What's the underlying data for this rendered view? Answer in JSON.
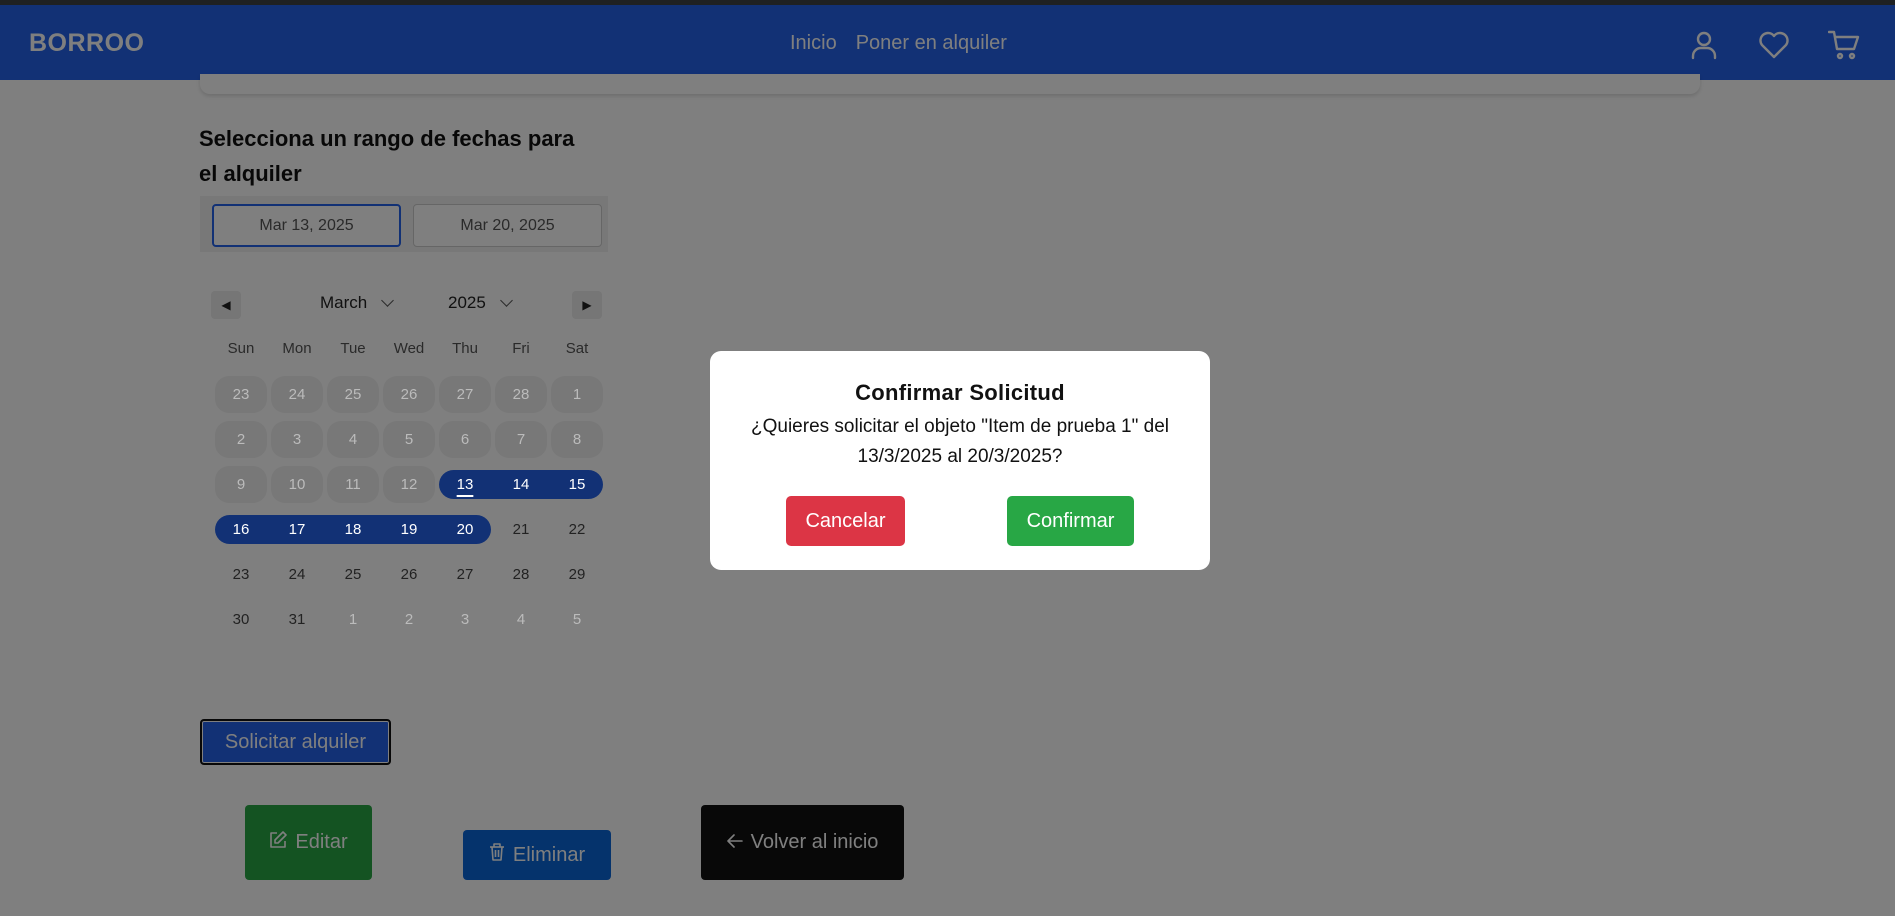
{
  "navbar": {
    "brand": "BORROO",
    "links": [
      "Inicio",
      "Poner en alquiler"
    ]
  },
  "rental": {
    "heading": "Selecciona un rango de fechas para el alquiler",
    "start_date": "Mar 13, 2025",
    "end_date": "Mar 20, 2025"
  },
  "calendar": {
    "month": "March",
    "year": "2025",
    "weekdays": [
      "Sun",
      "Mon",
      "Tue",
      "Wed",
      "Thu",
      "Fri",
      "Sat"
    ],
    "weeks": [
      [
        "23",
        "24",
        "25",
        "26",
        "27",
        "28",
        "1"
      ],
      [
        "2",
        "3",
        "4",
        "5",
        "6",
        "7",
        "8"
      ],
      [
        "9",
        "10",
        "11",
        "12",
        "13",
        "14",
        "15"
      ],
      [
        "16",
        "17",
        "18",
        "19",
        "20",
        "21",
        "22"
      ],
      [
        "23",
        "24",
        "25",
        "26",
        "27",
        "28",
        "29"
      ],
      [
        "30",
        "31",
        "1",
        "2",
        "3",
        "4",
        "5"
      ]
    ],
    "selected_range": [
      "13",
      "20"
    ],
    "accent": "#2563eb"
  },
  "actions": {
    "solicitar": "Solicitar alquiler",
    "editar": "Editar",
    "eliminar": "Eliminar",
    "volver": "Volver al inicio"
  },
  "modal": {
    "title": "Confirmar Solicitud",
    "message": "¿Quieres solicitar el objeto \"Item de prueba 1\" del 13/3/2025 al 20/3/2025?",
    "cancel": "Cancelar",
    "confirm": "Confirmar"
  },
  "colors": {
    "primary": "#2563eb",
    "success": "#28a745",
    "danger": "#dc3545",
    "dark": "#111111"
  },
  "icons": {
    "user": "user-icon",
    "favorites": "heart-icon",
    "cart": "cart-icon",
    "edit": "edit-icon",
    "delete": "trash-icon",
    "back": "arrow-left-icon"
  }
}
